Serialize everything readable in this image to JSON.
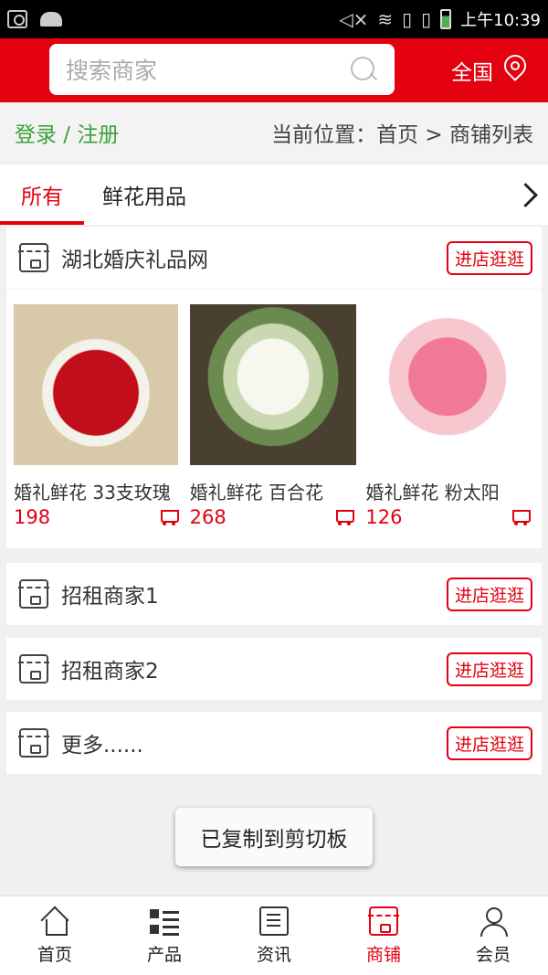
{
  "status_bar": {
    "time": "上午10:39",
    "icons": [
      "camera-icon",
      "android-icon",
      "mute-icon",
      "wifi-icon",
      "sim1-icon",
      "sim2-icon",
      "battery-icon"
    ]
  },
  "header": {
    "search_placeholder": "搜索商家",
    "region_label": "全国",
    "accent_color": "#e3000f"
  },
  "infobar": {
    "login_label": "登录 / 注册",
    "breadcrumb": "当前位置：首页 > 商铺列表"
  },
  "tabs": [
    {
      "label": "所有",
      "active": true
    },
    {
      "label": "鲜花用品",
      "active": false
    }
  ],
  "shops": [
    {
      "name": "湖北婚庆礼品网",
      "enter_label": "进店逛逛",
      "products": [
        {
          "name": "婚礼鲜花 33支玫瑰",
          "price": "198"
        },
        {
          "name": "婚礼鲜花 百合花",
          "price": "268"
        },
        {
          "name": "婚礼鲜花 粉太阳",
          "price": "126"
        }
      ]
    },
    {
      "name": "招租商家1",
      "enter_label": "进店逛逛"
    },
    {
      "name": "招租商家2",
      "enter_label": "进店逛逛"
    },
    {
      "name": "更多......",
      "enter_label": "进店逛逛"
    }
  ],
  "toast": "已复制到剪切板",
  "bottom_nav": [
    {
      "label": "首页",
      "icon": "home-icon",
      "active": false
    },
    {
      "label": "产品",
      "icon": "grid-list-icon",
      "active": false
    },
    {
      "label": "资讯",
      "icon": "news-icon",
      "active": false
    },
    {
      "label": "商铺",
      "icon": "store-icon",
      "active": true
    },
    {
      "label": "会员",
      "icon": "user-icon",
      "active": false
    }
  ]
}
